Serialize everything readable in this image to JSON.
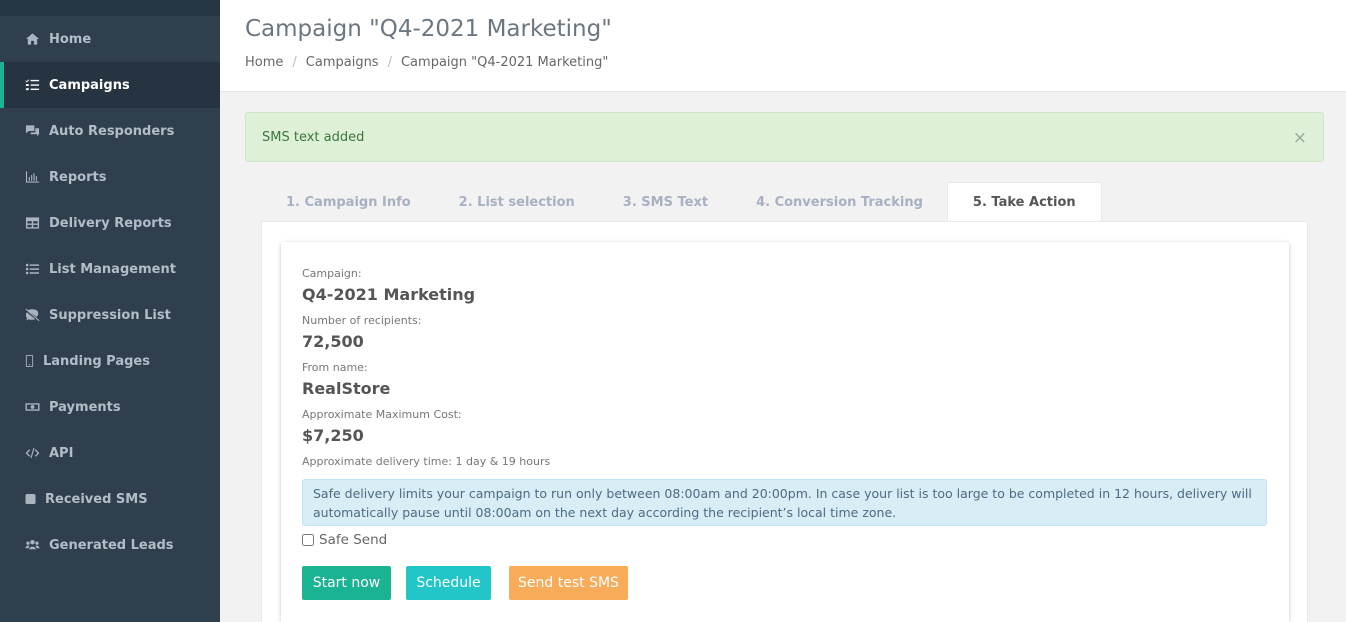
{
  "sidebar": {
    "items": [
      {
        "label": "Home",
        "icon": "home-icon",
        "active": false
      },
      {
        "label": "Campaigns",
        "icon": "tasks-list-icon",
        "active": true
      },
      {
        "label": "Auto Responders",
        "icon": "comments-icon",
        "active": false
      },
      {
        "label": "Reports",
        "icon": "bar-chart-icon",
        "active": false
      },
      {
        "label": "Delivery Reports",
        "icon": "table-icon",
        "active": false
      },
      {
        "label": "List Management",
        "icon": "list-icon",
        "active": false
      },
      {
        "label": "Suppression List",
        "icon": "comment-slash-icon",
        "active": false
      },
      {
        "label": "Landing Pages",
        "icon": "mobile-icon",
        "active": false
      },
      {
        "label": "Payments",
        "icon": "money-bill-icon",
        "active": false
      },
      {
        "label": "API",
        "icon": "code-icon",
        "active": false
      },
      {
        "label": "Received SMS",
        "icon": "sms-icon",
        "active": false
      },
      {
        "label": "Generated Leads",
        "icon": "users-icon",
        "active": false
      }
    ]
  },
  "header": {
    "title": "Campaign \"Q4-2021 Marketing\"",
    "breadcrumb": [
      "Home",
      "Campaigns",
      "Campaign \"Q4-2021 Marketing\""
    ],
    "breadcrumb_separator": "/"
  },
  "alert": {
    "message": "SMS text added",
    "close_glyph": "×"
  },
  "tabs": [
    {
      "label": "1. Campaign Info",
      "active": false
    },
    {
      "label": "2. List selection",
      "active": false
    },
    {
      "label": "3. SMS Text",
      "active": false
    },
    {
      "label": "4. Conversion Tracking",
      "active": false
    },
    {
      "label": "5. Take Action",
      "active": true
    }
  ],
  "summary": {
    "campaign_label": "Campaign:",
    "campaign_value": "Q4-2021 Marketing",
    "recipients_label": "Number of recipients:",
    "recipients_value": "72,500",
    "from_label": "From name:",
    "from_value": "RealStore",
    "cost_label": "Approximate Maximum Cost:",
    "cost_value": "$7,250",
    "delivery_time": "Approximate delivery time: 1 day & 19 hours"
  },
  "safe_delivery": {
    "info": "Safe delivery limits your campaign to run only between 08:00am and 20:00pm. In case your list is too large to be completed in 12 hours, delivery will automatically pause until 08:00am on the next day according the recipient’s local time zone.",
    "checkbox_label": "Safe Send",
    "checked": false
  },
  "actions": {
    "start_label": "Start now",
    "schedule_label": "Schedule",
    "test_label": "Send test SMS"
  },
  "colors": {
    "accent": "#1ab394",
    "info": "#23c6c8",
    "warning": "#f8ac59",
    "sidebar_bg": "#2f3f4e",
    "alert_success_bg": "#dff0d8",
    "alert_info_bg": "#d9edf7"
  }
}
